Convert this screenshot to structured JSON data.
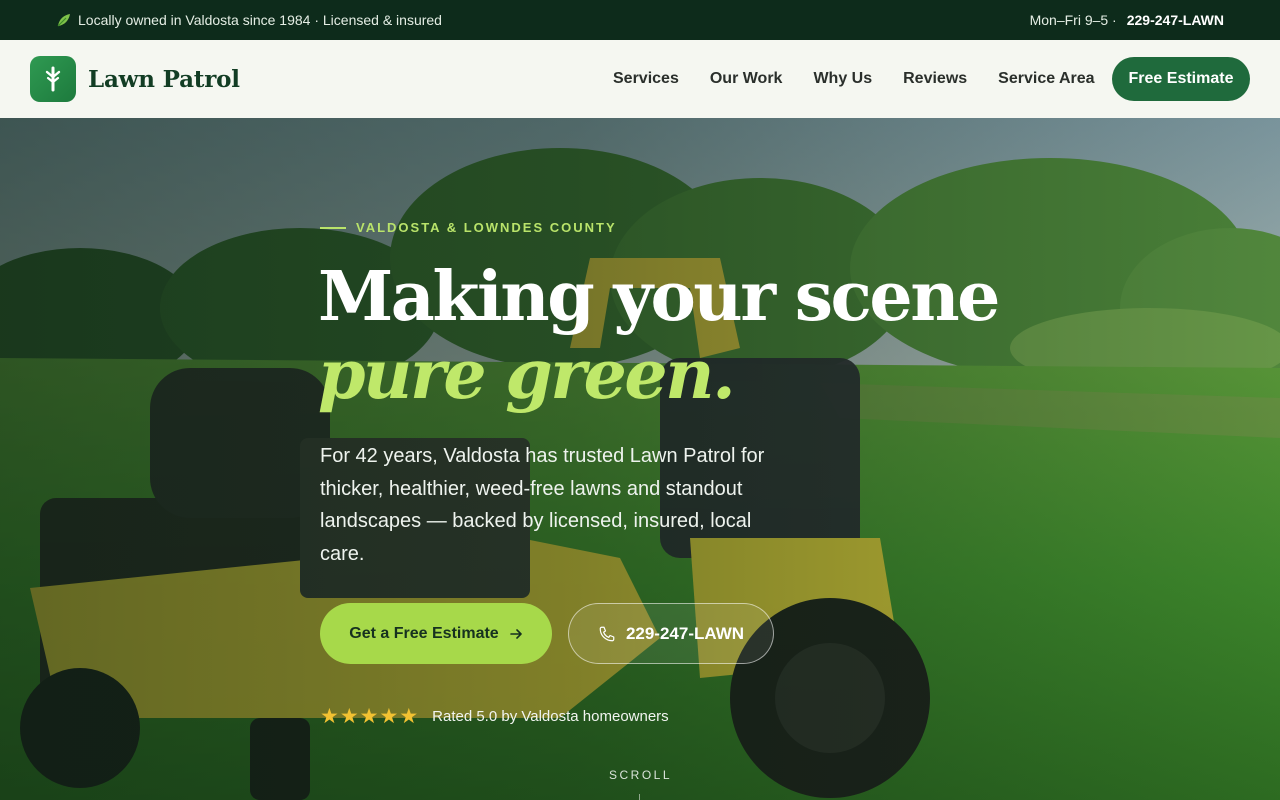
{
  "topbar": {
    "left_icon": "leaf-icon",
    "left_text": "Locally owned in Valdosta since 1984 · Licensed & insured",
    "hours": "Mon–Fri 9–5 ·",
    "phone": "229-247-LAWN"
  },
  "nav": {
    "brand_name": "Lawn Patrol",
    "logo_icon": "tree-icon",
    "links": [
      "Services",
      "Our Work",
      "Why Us",
      "Reviews",
      "Service Area"
    ],
    "cta": "Free Estimate"
  },
  "hero": {
    "eyebrow": "VALDOSTA & LOWNDES COUNTY",
    "headline_line1": "Making your scene",
    "headline_line2": "pure green.",
    "lede": "For 42 years, Valdosta has trusted Lawn Patrol for thicker, healthier, weed-free lawns and standout landscapes — backed by licensed, insured, local care.",
    "primary_cta": "Get a Free Estimate",
    "primary_cta_icon": "arrow-right-icon",
    "secondary_cta": "229-247-LAWN",
    "secondary_cta_icon": "phone-icon",
    "stars": 5,
    "rating_text": "Rated 5.0 by Valdosta homeowners",
    "scroll_label": "SCROLL",
    "background": "photo of yellow stand-on lawn mower on green lawn with trees"
  },
  "colors": {
    "topbar_bg": "#0d2b1b",
    "nav_bg": "#f5f7f1",
    "brand_green": "#1f6a3c",
    "accent_lime": "#a7d94a",
    "headline_accent": "#bfe86a",
    "star": "#f2c232"
  }
}
